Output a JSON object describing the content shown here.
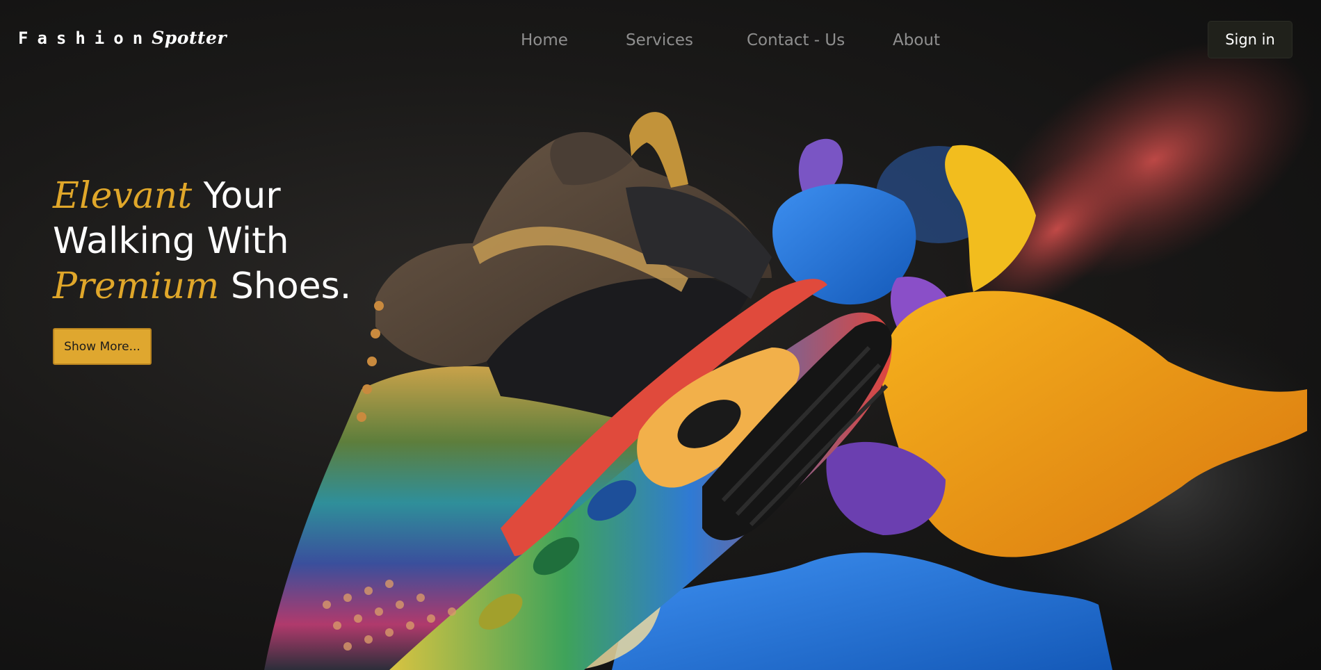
{
  "brand": {
    "name_first": "Fashion",
    "name_second": "Spotter"
  },
  "nav": {
    "items": [
      {
        "label": "Home"
      },
      {
        "label": "Services"
      },
      {
        "label": "Contact - Us"
      },
      {
        "label": "About"
      }
    ],
    "signin_label": "Sign in"
  },
  "hero": {
    "line1_accent": "Elevant",
    "line1_rest": "Your",
    "line2": "Walking With",
    "line3_accent": "Premium",
    "line3_rest": "Shoes.",
    "cta_label": "Show More..."
  },
  "colors": {
    "accent": "#e0a72a",
    "button": "#dfa72f",
    "background": "#111111",
    "signin_bg": "#20211b"
  },
  "hero_image": {
    "icon": "sneaker-paint-splash-image"
  }
}
